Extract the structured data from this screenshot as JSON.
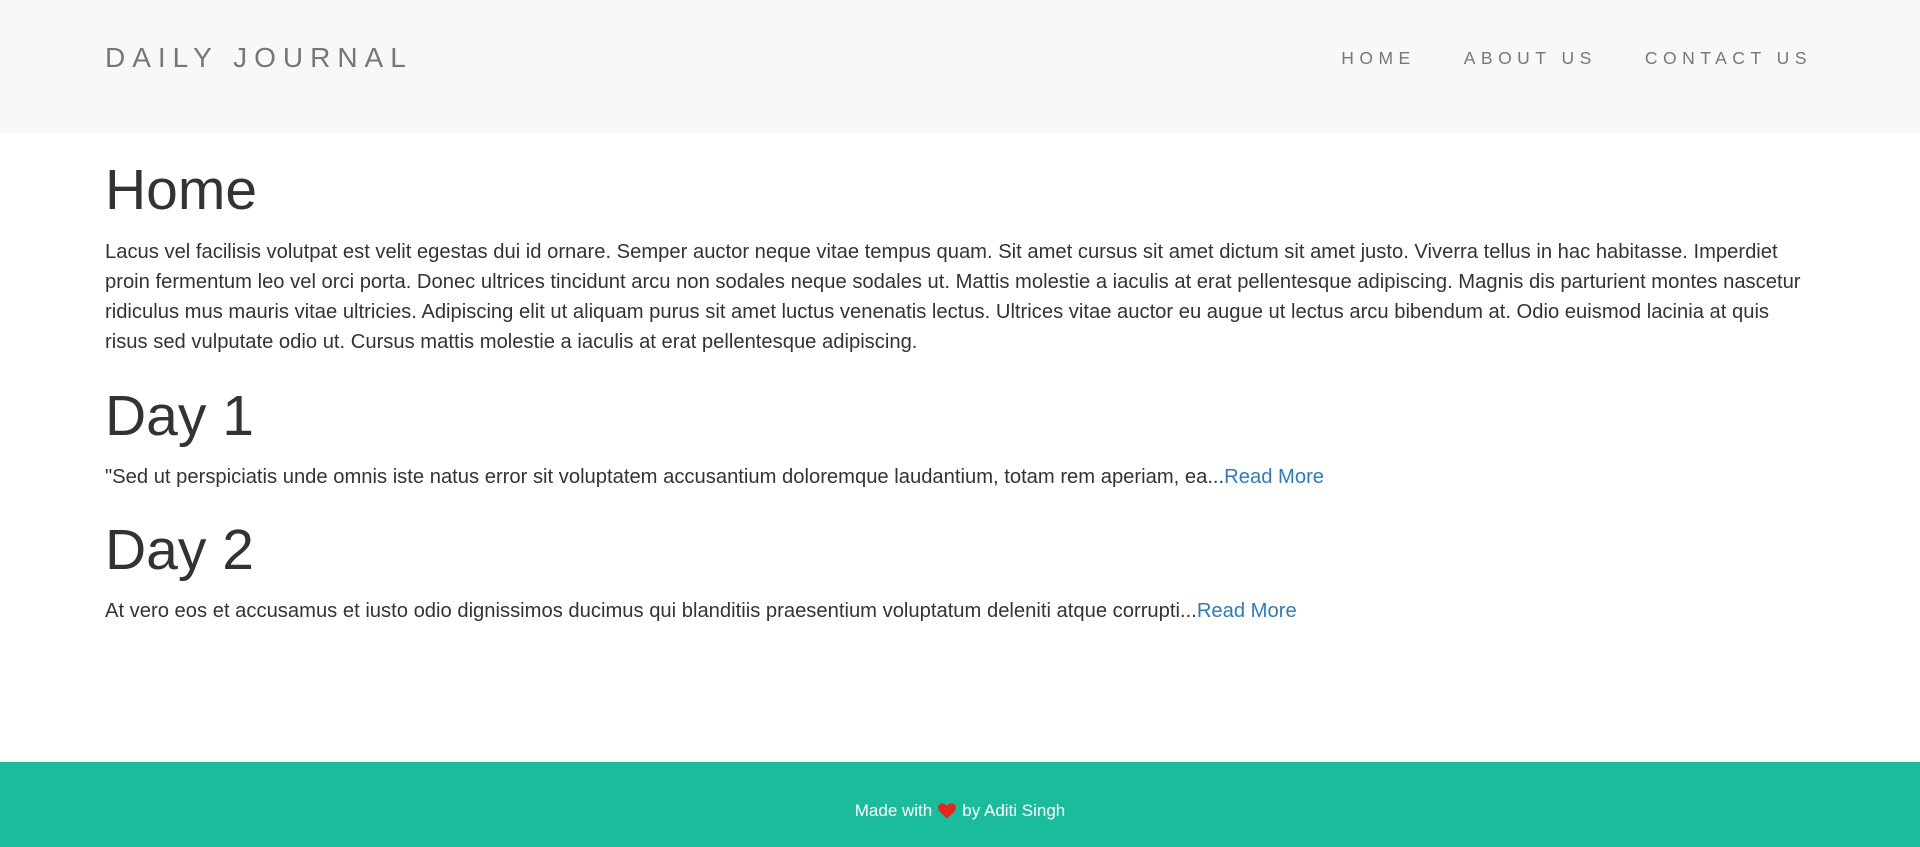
{
  "navbar": {
    "brand": "DAILY JOURNAL",
    "links": [
      {
        "label": "HOME"
      },
      {
        "label": "ABOUT US"
      },
      {
        "label": "CONTACT US"
      }
    ]
  },
  "home": {
    "title": "Home",
    "body": "Lacus vel facilisis volutpat est velit egestas dui id ornare. Semper auctor neque vitae tempus quam. Sit amet cursus sit amet dictum sit amet justo. Viverra tellus in hac habitasse. Imperdiet proin fermentum leo vel orci porta. Donec ultrices tincidunt arcu non sodales neque sodales ut. Mattis molestie a iaculis at erat pellentesque adipiscing. Magnis dis parturient montes nascetur ridiculus mus mauris vitae ultricies. Adipiscing elit ut aliquam purus sit amet luctus venenatis lectus. Ultrices vitae auctor eu augue ut lectus arcu bibendum at. Odio euismod lacinia at quis risus sed vulputate odio ut. Cursus mattis molestie a iaculis at erat pellentesque adipiscing."
  },
  "posts": [
    {
      "title": "Day 1",
      "excerpt": "\"Sed ut perspiciatis unde omnis iste natus error sit voluptatem accusantium doloremque laudantium, totam rem aperiam, ea...",
      "read_more": "Read More"
    },
    {
      "title": "Day 2",
      "excerpt": "At vero eos et accusamus et iusto odio dignissimos ducimus qui blanditiis praesentium voluptatum deleniti atque corrupti...",
      "read_more": "Read More"
    }
  ],
  "footer": {
    "prefix": "Made with",
    "icon": "heart-icon",
    "suffix": "by Aditi Singh"
  },
  "colors": {
    "navbar_bg": "#f8f8f8",
    "footer_bg": "#1abc9c",
    "link": "#337ab7",
    "heart": "#e5261f"
  }
}
